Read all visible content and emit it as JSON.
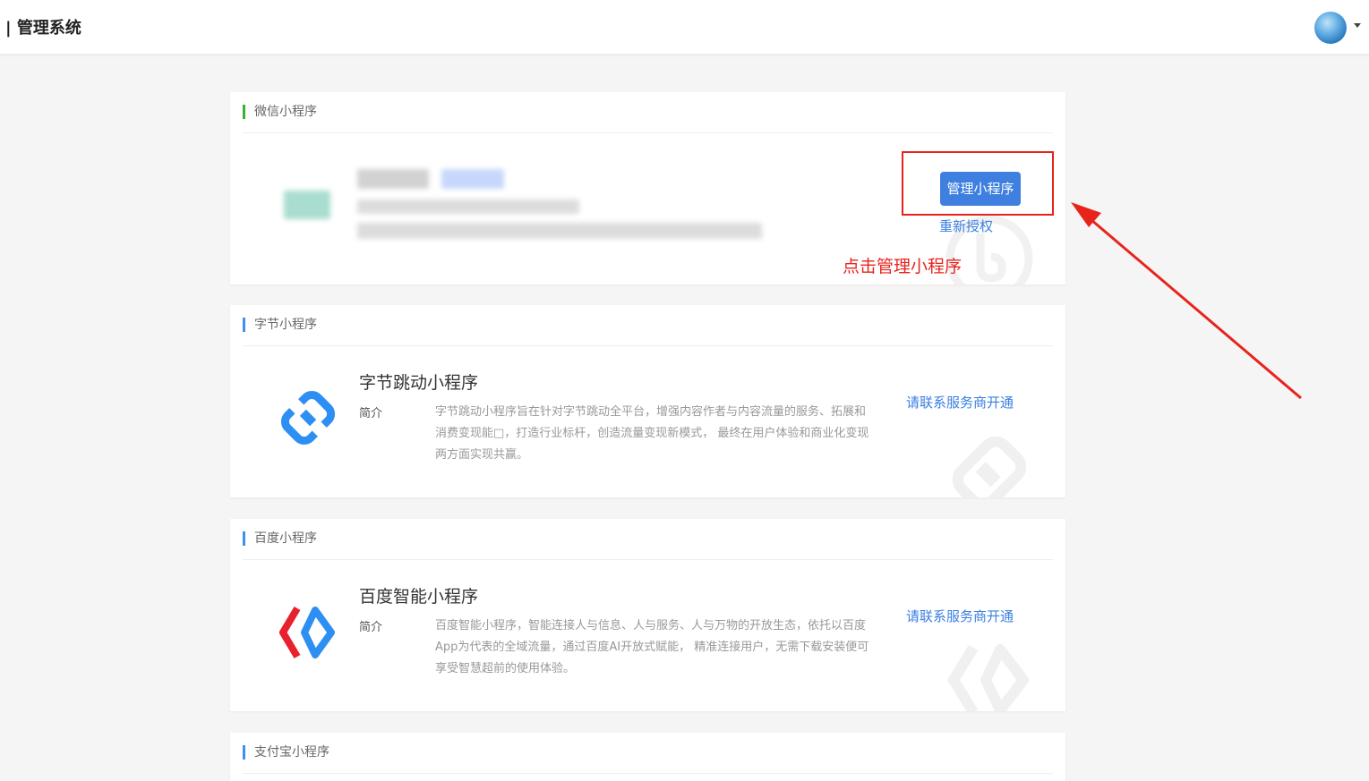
{
  "header": {
    "title": "| 管理系统"
  },
  "wechat": {
    "section_title": "微信小程序",
    "manage_button": "管理小程序",
    "reauth_link": "重新授权",
    "annotation": "点击管理小程序"
  },
  "bytedance": {
    "section_title": "字节小程序",
    "name": "字节跳动小程序",
    "intro_label": "简介",
    "intro_text": "字节跳动小程序旨在针对字节跳动全平台，增强内容作者与内容流量的服务、拓展和消费变现能□，打造行业标杆，创造流量变现新模式， 最终在用户体验和商业化变现两方面实现共赢。",
    "contact_link": "请联系服务商开通"
  },
  "baidu": {
    "section_title": "百度小程序",
    "name": "百度智能小程序",
    "intro_label": "简介",
    "intro_text": "百度智能小程序，智能连接人与信息、人与服务、人与万物的开放生态，依托以百度App为代表的全域流量，通过百度AI开放式赋能， 精准连接用户，无需下载安装便可享受智慧超前的使用体验。",
    "contact_link": "请联系服务商开通"
  },
  "alipay": {
    "section_title": "支付宝小程序"
  },
  "colors": {
    "accent_blue": "#3e7fe0",
    "annotation_red": "#e8231c",
    "wechat_green": "#3cb034"
  }
}
